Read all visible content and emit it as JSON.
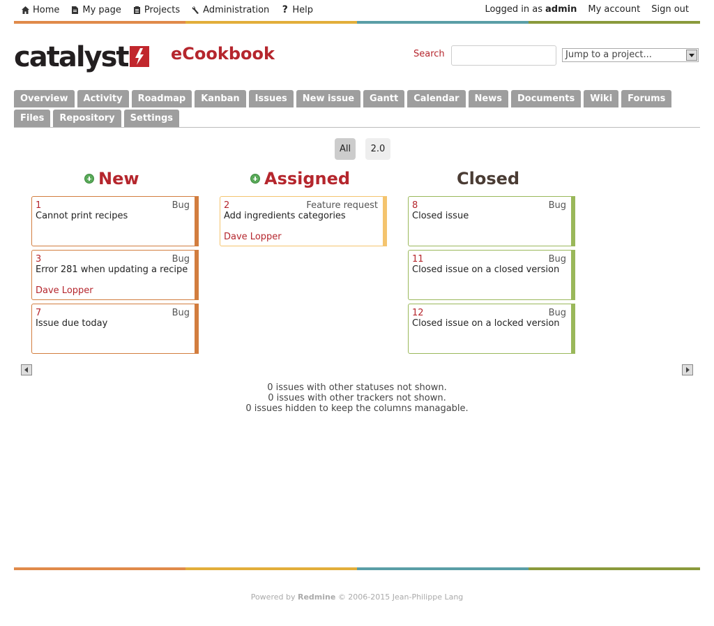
{
  "top_menu": {
    "home": "Home",
    "my_page": "My page",
    "projects": "Projects",
    "administration": "Administration",
    "help": "Help",
    "logged_in_prefix": "Logged in as",
    "user": "admin",
    "my_account": "My account",
    "sign_out": "Sign out"
  },
  "header": {
    "logo_text": "catalyst",
    "project_title": "eCookbook",
    "search_label": "Search",
    "search_value": "",
    "jump_placeholder": "Jump to a project..."
  },
  "tabs": [
    "Overview",
    "Activity",
    "Roadmap",
    "Kanban",
    "Issues",
    "New issue",
    "Gantt",
    "Calendar",
    "News",
    "Documents",
    "Wiki",
    "Forums",
    "Files",
    "Repository",
    "Settings"
  ],
  "version_filter": {
    "all": "All",
    "v20": "2.0",
    "selected": "All"
  },
  "columns": {
    "new": {
      "title": "New",
      "cards": [
        {
          "num": "1",
          "tracker": "Bug",
          "subject": "Cannot print recipes",
          "assignee": ""
        },
        {
          "num": "3",
          "tracker": "Bug",
          "subject": "Error 281 when updating a recipe",
          "assignee": "Dave Lopper"
        },
        {
          "num": "7",
          "tracker": "Bug",
          "subject": "Issue due today",
          "assignee": ""
        }
      ]
    },
    "assigned": {
      "title": "Assigned",
      "cards": [
        {
          "num": "2",
          "tracker": "Feature request",
          "subject": "Add ingredients categories",
          "assignee": "Dave Lopper"
        }
      ]
    },
    "closed": {
      "title": "Closed",
      "cards": [
        {
          "num": "8",
          "tracker": "Bug",
          "subject": "Closed issue",
          "assignee": ""
        },
        {
          "num": "11",
          "tracker": "Bug",
          "subject": "Closed issue on a closed version",
          "assignee": ""
        },
        {
          "num": "12",
          "tracker": "Bug",
          "subject": "Closed issue on a locked version",
          "assignee": ""
        }
      ]
    }
  },
  "notes": [
    "0 issues with other statuses not shown.",
    "0 issues with other trackers not shown.",
    "0 issues hidden to keep the columns managable."
  ],
  "footer": {
    "prefix": "Powered by",
    "brand": "Redmine",
    "suffix": "© 2006-2015 Jean-Philippe Lang"
  },
  "colors": {
    "accent": "#b5262d",
    "tab": "#9e9e9e",
    "new": "#d27d3e",
    "assigned": "#f4c46e",
    "closed": "#9ab85a"
  }
}
